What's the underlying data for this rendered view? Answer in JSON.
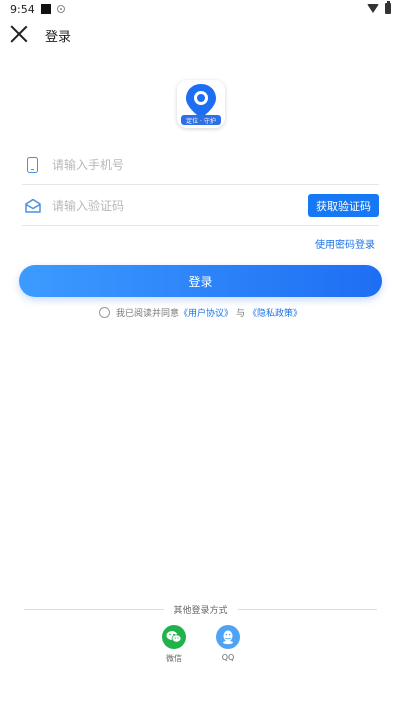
{
  "status_bar": {
    "time": "9:54"
  },
  "header": {
    "title": "登录"
  },
  "logo": {
    "banner_text": "定位 · 守护",
    "brand_color": "#2f6fe6"
  },
  "phone_field": {
    "placeholder": "请输入手机号",
    "value": ""
  },
  "code_field": {
    "placeholder": "请输入验证码",
    "value": ""
  },
  "get_code_button": {
    "label": "获取验证码"
  },
  "password_login_link": {
    "label": "使用密码登录"
  },
  "login_button": {
    "label": "登录"
  },
  "agreement": {
    "prefix": "我已阅读并同意",
    "user_agreement": "《用户协议》",
    "conjunction": "与",
    "privacy_policy": "《隐私政策》",
    "checked": false
  },
  "other_login": {
    "title": "其他登录方式",
    "options": [
      {
        "label": "微信",
        "icon": "wechat-icon"
      },
      {
        "label": "QQ",
        "icon": "qq-icon"
      }
    ]
  },
  "colors": {
    "accent": "#1678f5",
    "link": "#1a73e8",
    "wechat": "#22b24c",
    "qq": "#4fa3f5"
  }
}
